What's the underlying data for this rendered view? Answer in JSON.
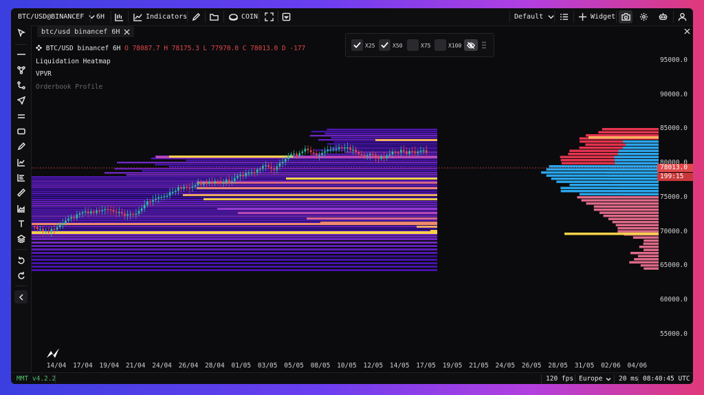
{
  "topbar": {
    "symbol": "BTC/USD@BINANCEF",
    "interval": "6H",
    "indicators_label": "Indicators",
    "coin_label": "COIN",
    "layout_label": "Default",
    "widget_label": "Widget"
  },
  "tab": {
    "title": "btc/usd binancef 6H"
  },
  "legend": {
    "series_title": "BTC/USD binancef 6H",
    "ohlc": "O 78087.7 H 78175.3 L 77970.0 C 78013.0 D -177",
    "indicators": [
      "Liquidation Heatmap",
      "VPVR",
      "Orderbook Profile"
    ]
  },
  "leverage_filter": {
    "options": [
      {
        "label": "X25",
        "checked": true
      },
      {
        "label": "X50",
        "checked": true
      },
      {
        "label": "X75",
        "checked": false
      },
      {
        "label": "X100",
        "checked": false
      }
    ]
  },
  "y_axis": {
    "ticks": [
      "95000.0",
      "90000.0",
      "85000.0",
      "80000.0",
      "75000.0",
      "70000.0",
      "65000.0",
      "60000.0",
      "55000.0"
    ]
  },
  "x_axis": {
    "ticks": [
      "14/04",
      "17/04",
      "19/04",
      "21/04",
      "24/04",
      "26/04",
      "28/04",
      "01/05",
      "03/05",
      "05/05",
      "08/05",
      "10/05",
      "12/05",
      "14/05",
      "17/05",
      "19/05",
      "21/05",
      "24/05",
      "26/05",
      "28/05",
      "31/05",
      "02/06",
      "04/06"
    ]
  },
  "price_labels": {
    "last_price": "78013.0",
    "countdown": "199:15"
  },
  "status": {
    "version": "MMT v4.2.2",
    "fps": "120 fps",
    "region": "Europe",
    "latency": "20 ms",
    "clock": "08:40:45 UTC"
  },
  "colors": {
    "accent_red": "#e0484a",
    "heatmap_yellow": "#f6d24a",
    "heatmap_purple": "#5a18c8",
    "vpvr_blue": "#2aa7ee",
    "candle_green": "#2bbfa3"
  }
}
